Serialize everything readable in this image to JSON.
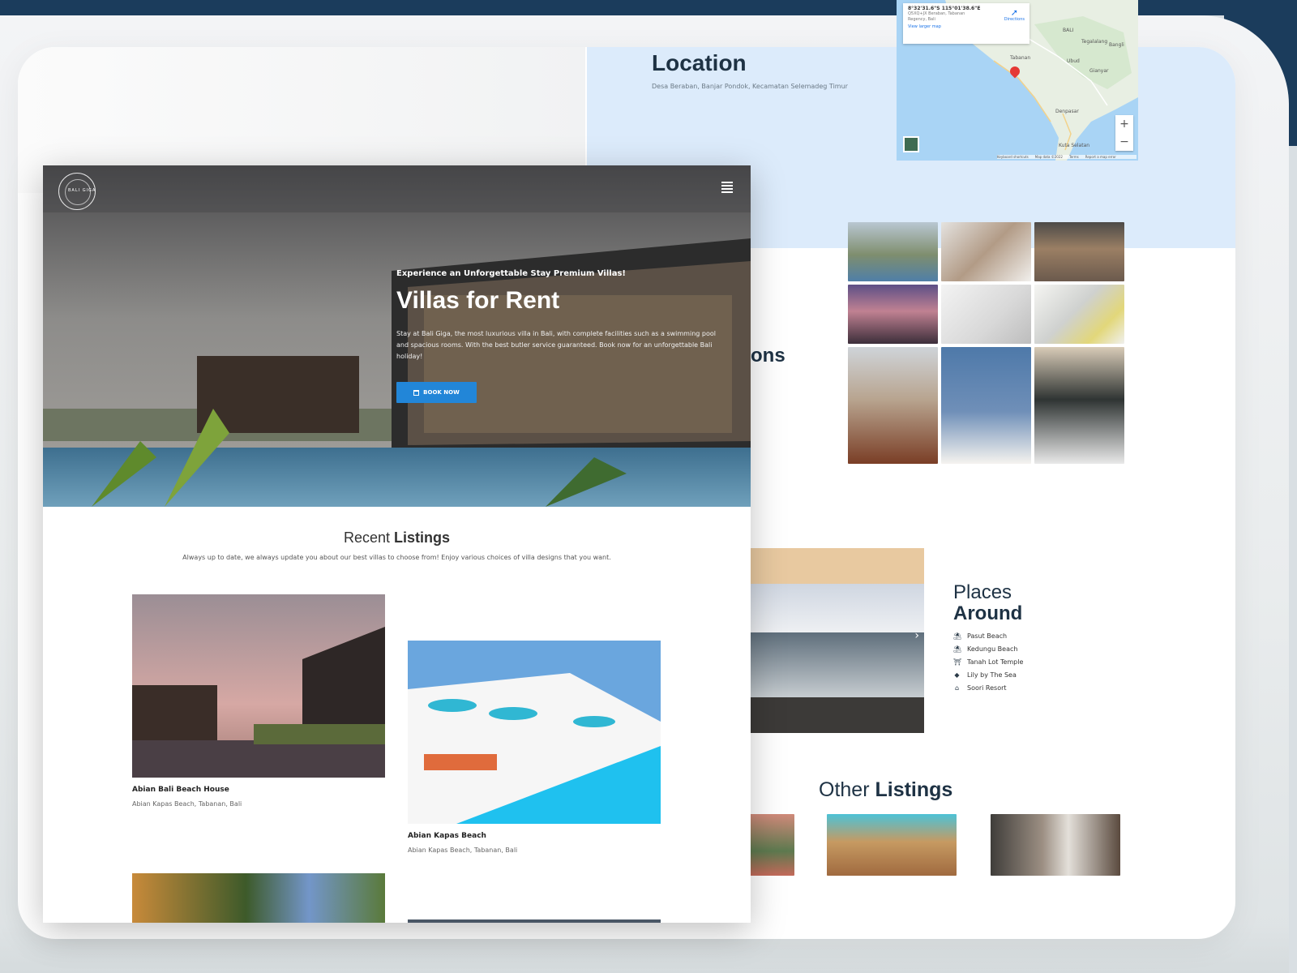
{
  "location": {
    "title": "Location",
    "address": "Desa Beraban, Banjar Pondok, Kecamatan Selemadeg Timur"
  },
  "map": {
    "coordinates": "8°32'31.6\"S 115°01'38.6\"E",
    "address_line": "Q5XQ+JX Beraban, Tabanan Regency, Bali",
    "view_larger": "View larger map",
    "directions": "Directions",
    "zoom_in": "+",
    "zoom_out": "−",
    "labels": {
      "bali": "BALI",
      "tegalalang": "Tegalalang",
      "ubud": "Ubud",
      "denpasar": "Denpasar",
      "gianyar": "Gianyar",
      "kuta": "Kuta Selatan",
      "tabanan": "Tabanan",
      "bangli": "Bangli"
    },
    "attribution": [
      "Keyboard shortcuts",
      "Map data ©2022",
      "Terms",
      "Report a map error"
    ]
  },
  "amenities_heading_partial": "ons",
  "places": {
    "title_line1": "Places",
    "title_line2": "Around",
    "items": [
      {
        "icon": "umbrella-icon",
        "glyph": "⛱",
        "label": "Pasut Beach"
      },
      {
        "icon": "umbrella-icon",
        "glyph": "⛱",
        "label": "Kedungu Beach"
      },
      {
        "icon": "temple-icon",
        "glyph": "⛩",
        "label": "Tanah Lot Temple"
      },
      {
        "icon": "fish-icon",
        "glyph": "◆",
        "label": "Lily by The Sea"
      },
      {
        "icon": "resort-icon",
        "glyph": "⌂",
        "label": "Soori Resort"
      }
    ],
    "carousel_next": "›"
  },
  "other": {
    "title_light": "Other",
    "title_bold": "Listings"
  },
  "hero": {
    "logo": "BALI GIGA",
    "eyebrow": "Experience an Unforgettable Stay Premium Villas!",
    "title": "Villas for Rent",
    "description": "Stay at Bali Giga, the most luxurious villa in Bali, with complete facilities such as a swimming pool and spacious rooms. With the best butler service guaranteed. Book now for an unforgettable Bali holiday!",
    "book_button": "BOOK NOW"
  },
  "recent": {
    "title_light": "Recent",
    "title_bold": "Listings",
    "description": "Always up to date, we always update you about our best villas to choose from! Enjoy various choices of villa designs that you want.",
    "listings": [
      {
        "name": "Abian Bali Beach House",
        "location": "Abian Kapas Beach, Tabanan, Bali"
      },
      {
        "name": "Abian Kapas Beach",
        "location": "Abian Kapas Beach, Tabanan, Bali"
      }
    ]
  },
  "colors": {
    "navy": "#1b3c5c",
    "accent_blue": "#2286d8",
    "location_band": "#dcebfb",
    "heading": "#1e3244"
  }
}
